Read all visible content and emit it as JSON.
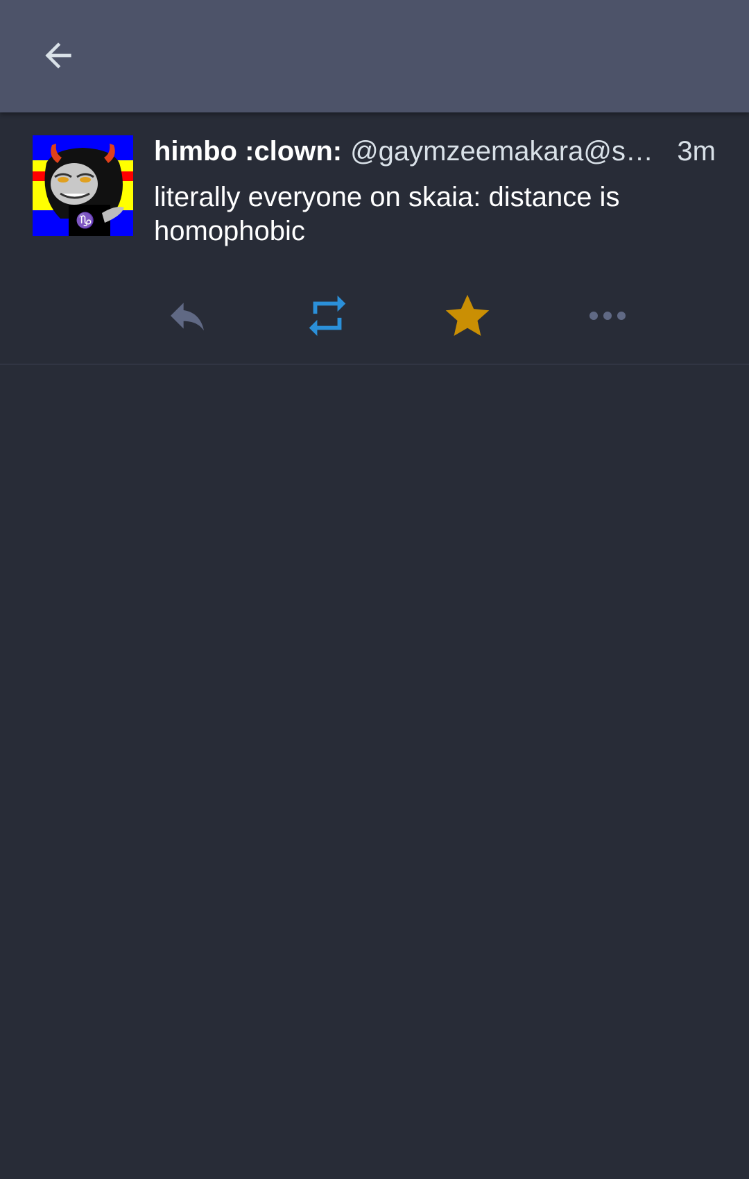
{
  "toolbar": {
    "back_icon": "arrow-left-icon"
  },
  "status": {
    "display_name": "himbo :clown:",
    "acct": "@gaymzeemakara@sk…",
    "timestamp": "3m",
    "content": "literally everyone on skaia: distance is homophobic",
    "avatar_icon": "avatar-clown-troll"
  },
  "actions": {
    "reply_icon": "reply-icon",
    "boost_icon": "boost-icon",
    "favourite_icon": "star-icon",
    "more_icon": "more-icon"
  },
  "colors": {
    "toolbar_bg": "#4d5369",
    "page_bg": "#282c37",
    "boost_active": "#2b90d9",
    "favourite_active": "#ca8f04",
    "icon_inactive": "#606984"
  }
}
